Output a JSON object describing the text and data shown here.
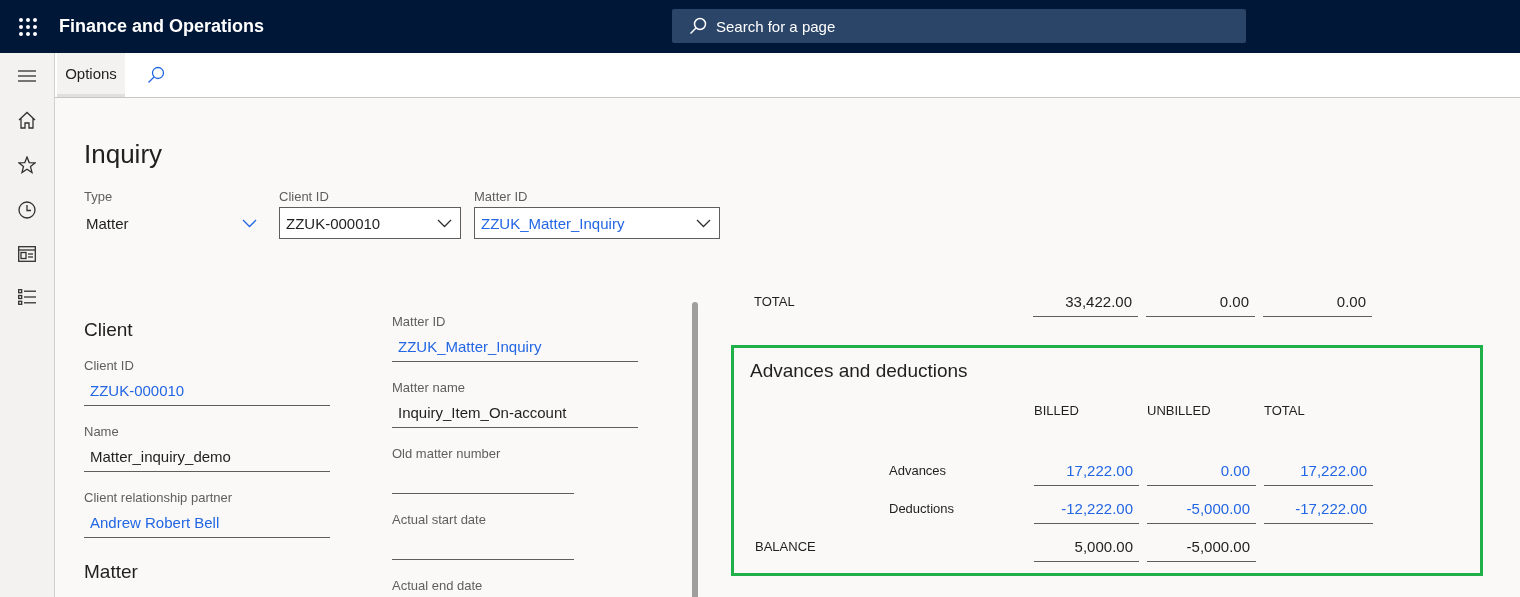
{
  "app_bar": {
    "title": "Finance and Operations",
    "search": {
      "placeholder": "Search for a page"
    }
  },
  "action_pane": {
    "tabs": [
      {
        "label": "Options",
        "selected": true
      }
    ]
  },
  "page_title": "Inquiry",
  "filters": [
    {
      "label": "Type",
      "value": "Matter",
      "kind": "plain",
      "link": false
    },
    {
      "label": "Client ID",
      "value": "ZZUK-000010",
      "kind": "boxed",
      "link": false
    },
    {
      "label": "Matter ID",
      "value": "ZZUK_Matter_Inquiry",
      "kind": "boxed",
      "link": true
    }
  ],
  "form_columns": [
    [
      {
        "kind": "heading",
        "text": "Client"
      },
      {
        "kind": "field",
        "label": "Client ID",
        "value": "ZZUK-000010",
        "link": true
      },
      {
        "kind": "field",
        "label": "Name",
        "value": "Matter_inquiry_demo",
        "link": false
      },
      {
        "kind": "field",
        "label": "Client relationship partner",
        "value": "Andrew Robert Bell",
        "link": true
      },
      {
        "kind": "heading",
        "text": "Matter"
      }
    ],
    [
      {
        "kind": "field",
        "label": "Matter ID",
        "value": "ZZUK_Matter_Inquiry",
        "link": true
      },
      {
        "kind": "field",
        "label": "Matter name",
        "value": "Inquiry_Item_On-account",
        "link": false
      },
      {
        "kind": "field",
        "label": "Old matter number"
      },
      {
        "kind": "field",
        "label": "Actual start date"
      },
      {
        "kind": "field",
        "label": "Actual end date"
      }
    ]
  ],
  "totals_row": {
    "label": "TOTAL",
    "values": [
      "33,422.00",
      "0.00",
      "0.00"
    ]
  },
  "advances_panel": {
    "title": "Advances and deductions",
    "highlighted": true,
    "columns": [
      "BILLED",
      "UNBILLED",
      "TOTAL"
    ],
    "rows": [
      {
        "kind": "detail",
        "label": "Advances",
        "values": [
          "17,222.00",
          "0.00",
          "17,222.00"
        ],
        "link": true
      },
      {
        "kind": "detail",
        "label": "Deductions",
        "values": [
          "-12,222.00",
          "-5,000.00",
          "-17,222.00"
        ],
        "link": true
      },
      {
        "kind": "summary",
        "label": "BALANCE",
        "values": [
          "5,000.00",
          "-5,000.00"
        ],
        "link": false
      }
    ]
  }
}
